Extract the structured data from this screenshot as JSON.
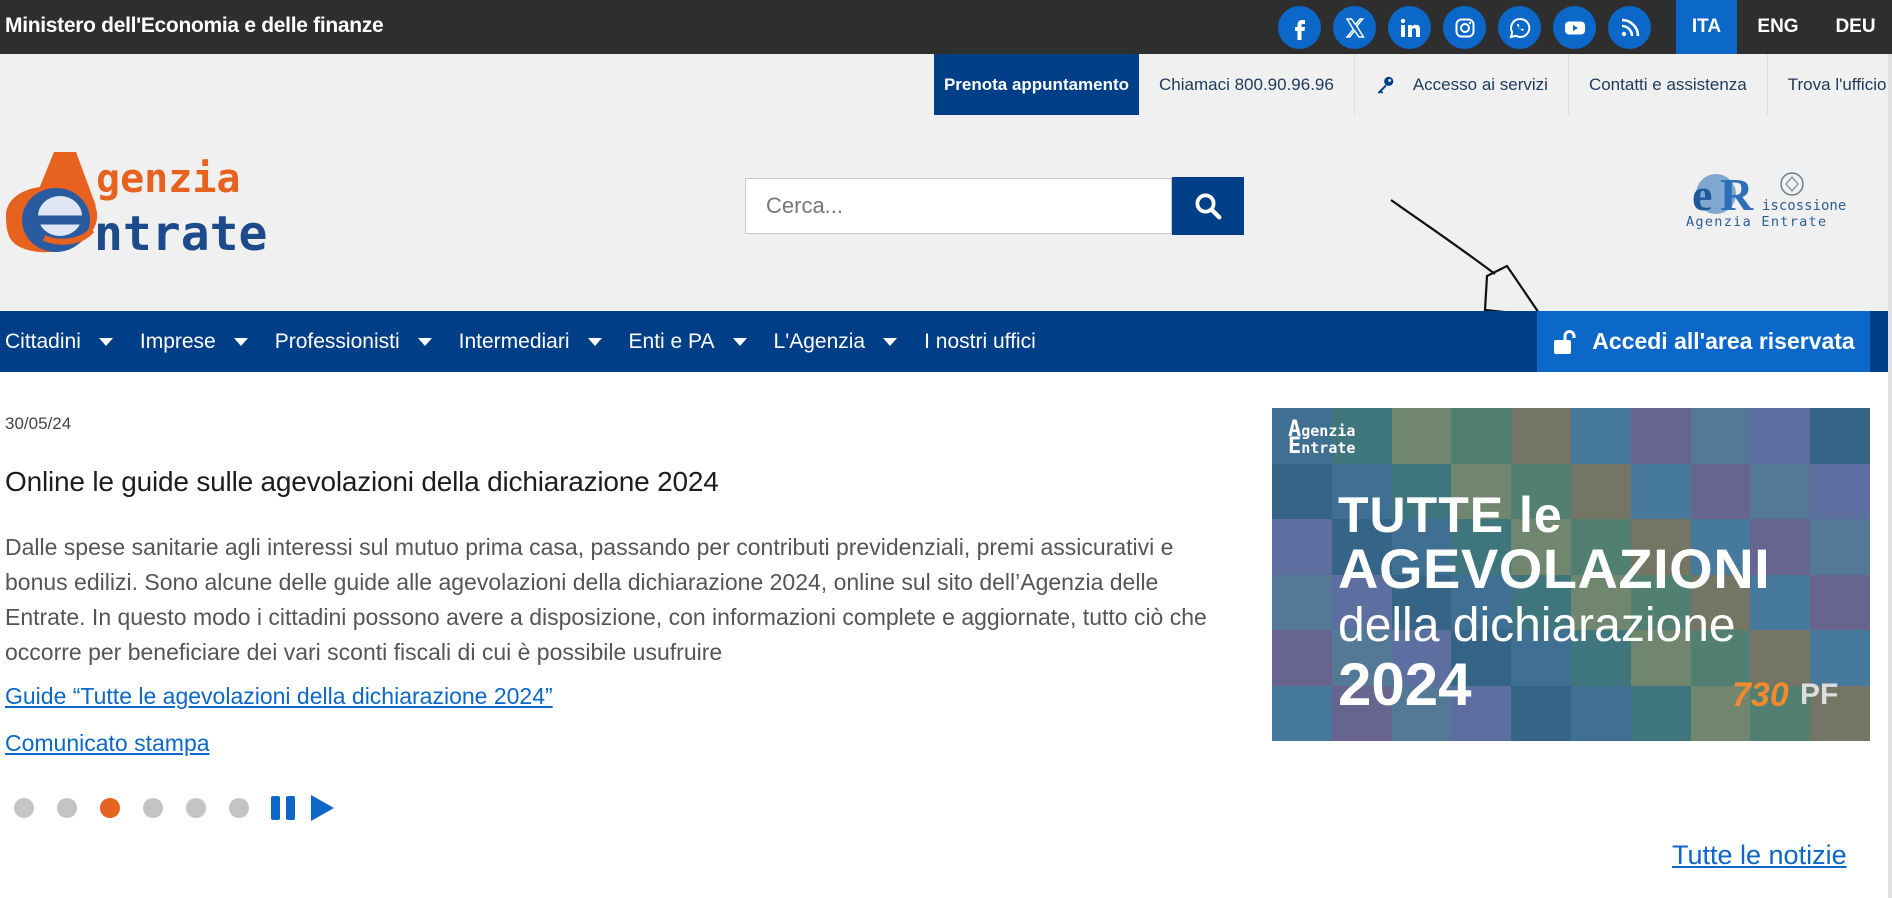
{
  "topbar": {
    "ministry": "Ministero dell'Economia e delle finanze",
    "socials": [
      "facebook-icon",
      "x-icon",
      "linkedin-icon",
      "instagram-icon",
      "whatsapp-icon",
      "youtube-icon",
      "rss-icon"
    ],
    "languages": [
      "ITA",
      "ENG",
      "DEU"
    ],
    "active_language": "ITA"
  },
  "utility": {
    "book": "Prenota appuntamento",
    "call": "Chiamaci 800.90.96.96",
    "services": "Accesso ai servizi",
    "contacts": "Contatti e assistenza",
    "office": "Trova l'ufficio"
  },
  "header": {
    "logo_line1": "genzia",
    "logo_line2": "ntrate",
    "search_placeholder": "Cerca...",
    "riscossione_line1": "iscossione",
    "riscossione_line2": "Agenzia Entrate"
  },
  "nav": {
    "items": [
      "Cittadini",
      "Imprese",
      "Professionisti",
      "Intermediari",
      "Enti e PA",
      "L'Agenzia",
      "I nostri uffici"
    ],
    "login": "Accedi all'area riservata"
  },
  "news": {
    "date": "30/05/24",
    "title": "Online le guide sulle agevolazioni della dichiarazione 2024",
    "body": "Dalle spese sanitarie agli interessi sul mutuo prima casa, passando per contributi previdenziali, premi assicurativi e bonus edilizi. Sono alcune delle guide alle agevolazioni della dichiarazione 2024, online sul sito dell’Agenzia delle Entrate. In questo modo i cittadini possono avere a disposizione, con informazioni complete e aggiornate, tutto ciò che occorre per beneficiare dei vari sconti fiscali di cui è possibile usufruire",
    "link1": "Guide “Tutte le agevolazioni della dichiarazione 2024”",
    "link2": "Comunicato stampa",
    "all_news": "Tutte le notizie",
    "slides_total": 6,
    "slide_active": 3
  },
  "banner": {
    "logo_line1": "genzia",
    "logo_line2": "ntrate",
    "line1": "TUTTE le",
    "line2": "AGEVOLAZIONI",
    "line3": "della dichiarazione",
    "line4": "2024",
    "badge1": "730",
    "badge2": "PF"
  },
  "colors": {
    "primary": "#003f88",
    "accent": "#0b67c8",
    "orange": "#e8621f",
    "topbar": "#2e2e2e"
  }
}
